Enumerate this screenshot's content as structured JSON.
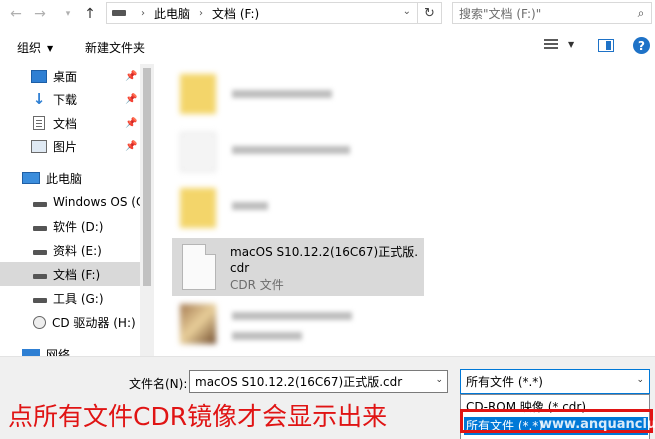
{
  "address_bar": {
    "crumbs": [
      "此电脑",
      "文档 (F:)"
    ],
    "search_placeholder": "搜索\"文档 (F:)\""
  },
  "toolbar": {
    "organize_label": "组织",
    "new_folder_label": "新建文件夹"
  },
  "nav": {
    "quick_access": [
      {
        "label": "桌面",
        "icon": "desktop-icon",
        "pinned": true
      },
      {
        "label": "下载",
        "icon": "download-icon",
        "pinned": true
      },
      {
        "label": "文档",
        "icon": "document-icon",
        "pinned": true
      },
      {
        "label": "图片",
        "icon": "picture-icon",
        "pinned": true
      }
    ],
    "this_pc_label": "此电脑",
    "drives": [
      {
        "label": "Windows OS (C",
        "icon": "drive-icon"
      },
      {
        "label": "软件 (D:)",
        "icon": "drive-icon"
      },
      {
        "label": "资料 (E:)",
        "icon": "drive-icon"
      },
      {
        "label": "文档 (F:)",
        "icon": "drive-icon",
        "selected": true
      },
      {
        "label": "工具 (G:)",
        "icon": "drive-icon"
      },
      {
        "label": "CD 驱动器 (H:)",
        "icon": "cd-drive-icon"
      }
    ],
    "network_label": "网络"
  },
  "content": {
    "selected_file": {
      "name": "macOS S10.12.2(16C67)正式版.cdr",
      "type": "CDR 文件"
    }
  },
  "bottom": {
    "filename_label": "文件名(N):",
    "filename_value": "macOS S10.12.2(16C67)正式版.cdr",
    "filter_value": "所有文件 (*.*)",
    "filter_options": [
      "CD-ROM 映像 (*.cdr)",
      "所有文件 (*.*)"
    ]
  },
  "annotation": {
    "text": "点所有文件CDR镜像才会显示出来",
    "color": "#e01414"
  },
  "watermark": "www.anquanclub.cn",
  "colors": {
    "accent": "#0078d7",
    "selection": "#d9d9d9",
    "annotation_red": "#e01414"
  }
}
